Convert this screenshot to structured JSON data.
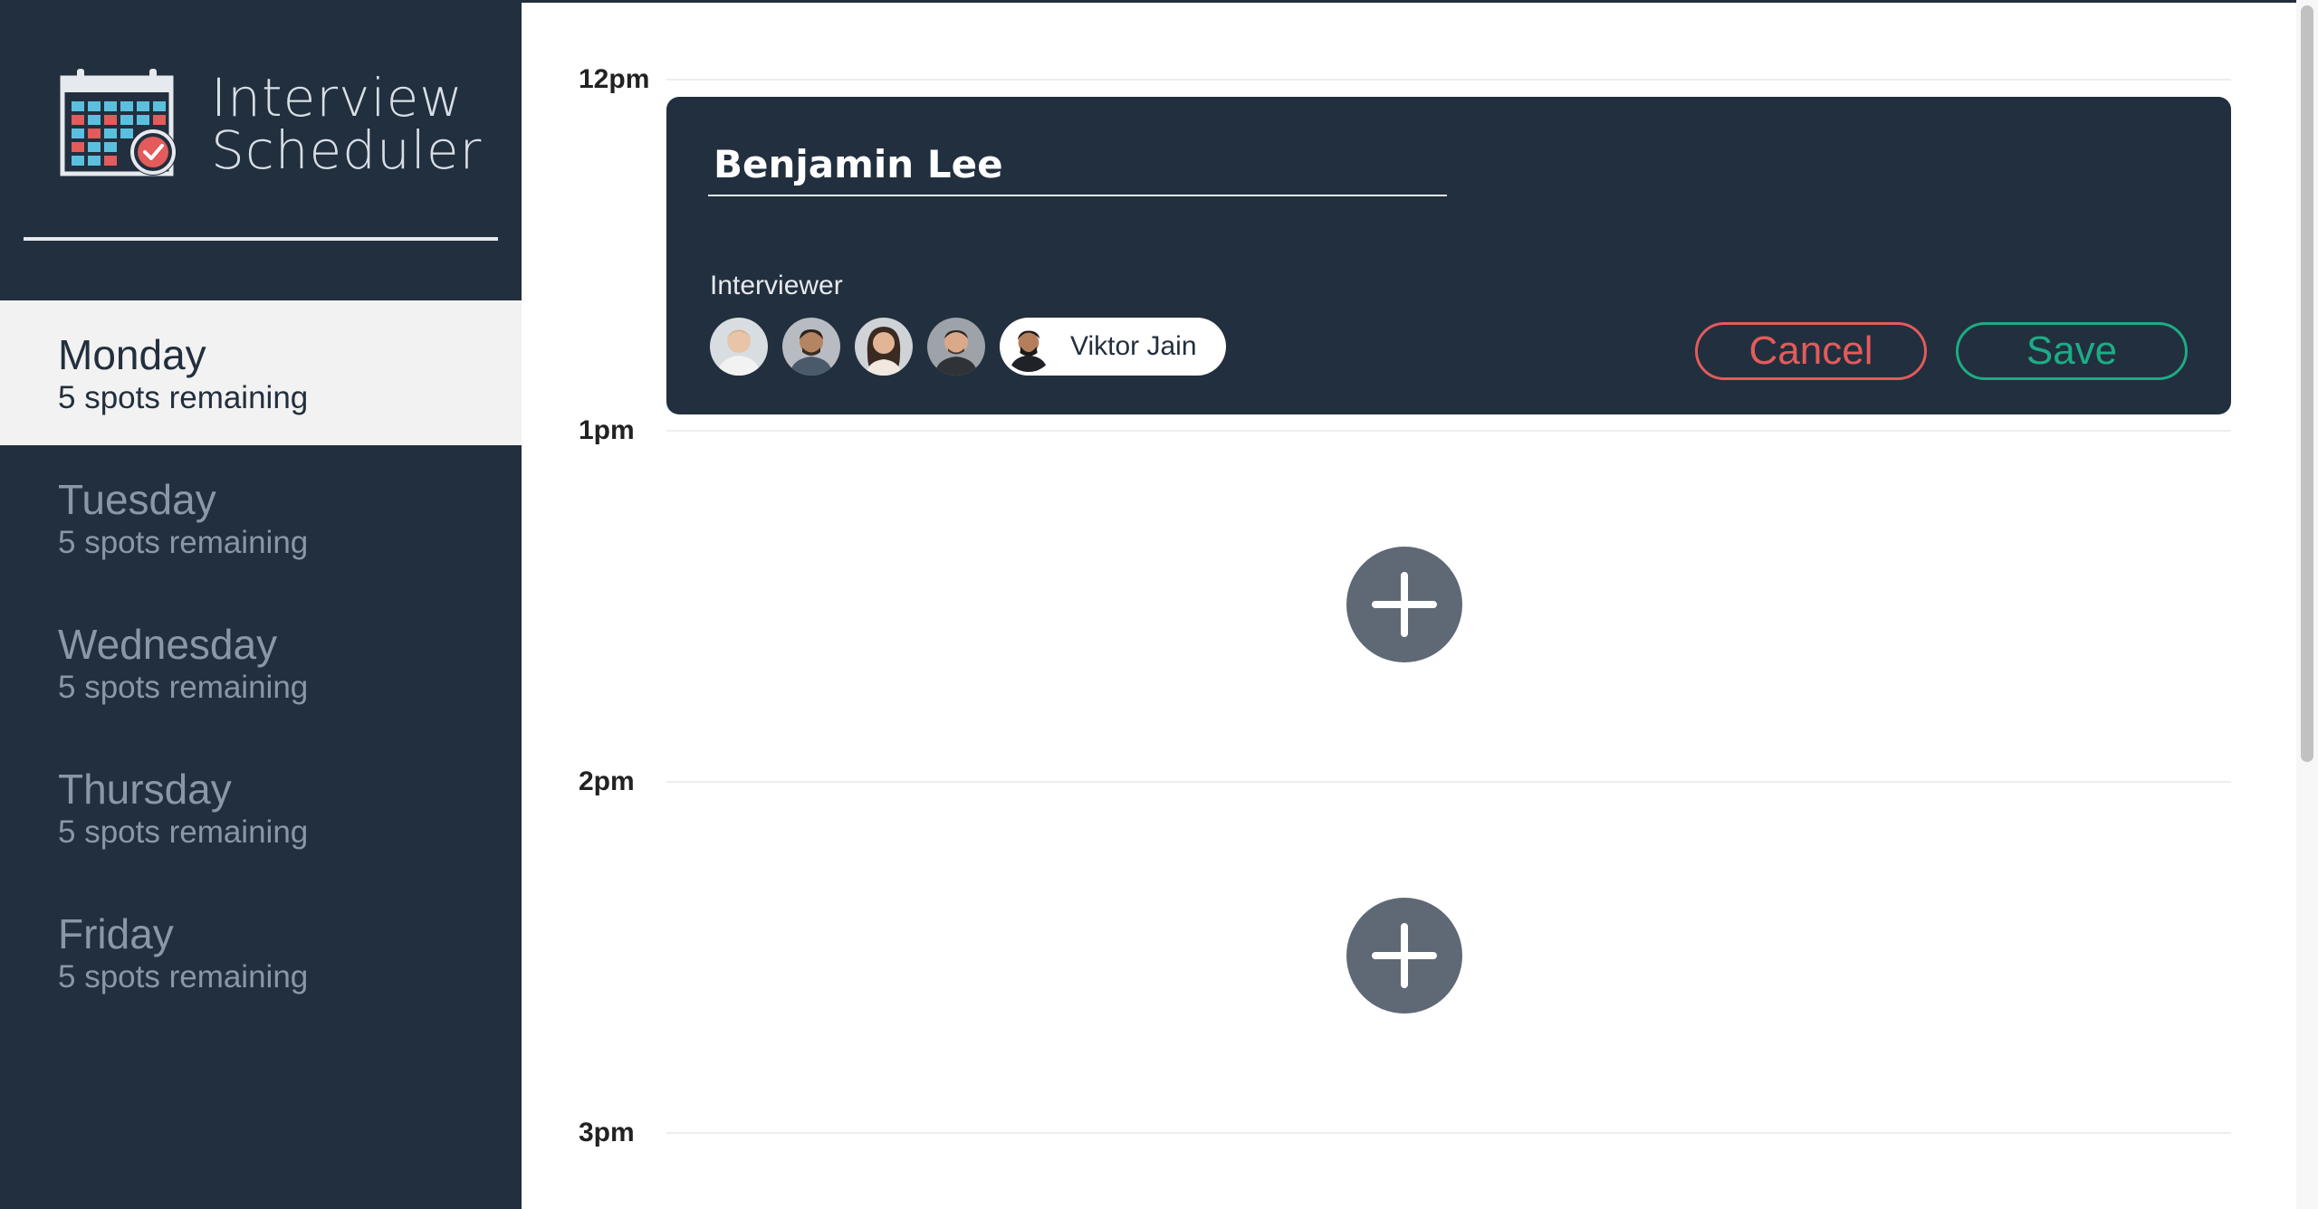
{
  "app": {
    "title_line1": "Interview",
    "title_line2": "Scheduler"
  },
  "days": [
    {
      "name": "Monday",
      "spots": "5 spots remaining",
      "selected": true
    },
    {
      "name": "Tuesday",
      "spots": "5 spots remaining",
      "selected": false
    },
    {
      "name": "Wednesday",
      "spots": "5 spots remaining",
      "selected": false
    },
    {
      "name": "Thursday",
      "spots": "5 spots remaining",
      "selected": false
    },
    {
      "name": "Friday",
      "spots": "5 spots remaining",
      "selected": false
    }
  ],
  "schedule": {
    "times": [
      "12pm",
      "1pm",
      "2pm",
      "3pm"
    ]
  },
  "form": {
    "student_name": "Benjamin Lee",
    "interviewer_label": "Interviewer",
    "selected_interviewer": "Viktor Jain",
    "cancel_label": "Cancel",
    "save_label": "Save"
  },
  "colors": {
    "sidebar": "#222f3e",
    "selected_day_bg": "#f2f2f2",
    "cancel": "#e35b5b",
    "save": "#1dac85",
    "add_button": "#5f6975"
  }
}
